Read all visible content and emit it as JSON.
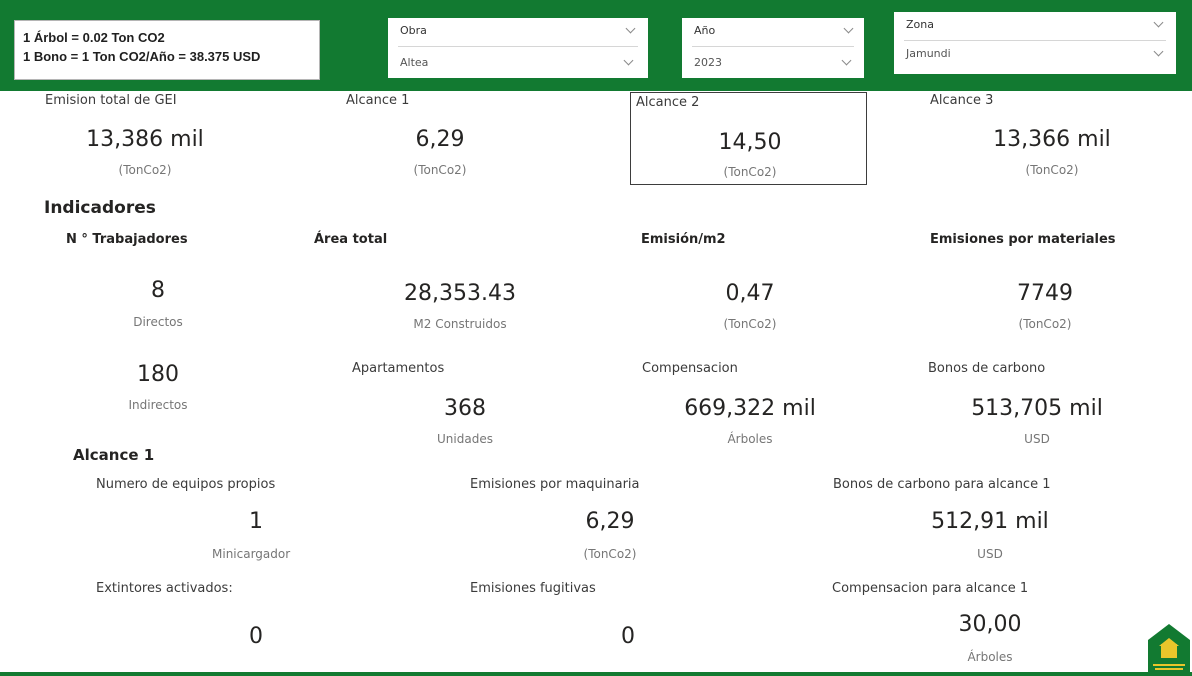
{
  "info": {
    "line1": "1 Árbol = 0.02 Ton CO2",
    "line2": "1 Bono = 1 Ton CO2/Año = 38.375 USD"
  },
  "filters": {
    "obra": {
      "title": "Obra",
      "value": "Altea"
    },
    "anio": {
      "title": "Año",
      "value": "2023"
    },
    "zona": {
      "title": "Zona",
      "value": "Jamundi"
    }
  },
  "emissions": {
    "total": {
      "label": "Emision total de GEI",
      "value": "13,386 mil",
      "unit": "(TonCo2)"
    },
    "alcance1": {
      "label": "Alcance 1",
      "value": "6,29",
      "unit": "(TonCo2)"
    },
    "alcance2": {
      "label": "Alcance 2",
      "value": "14,50",
      "unit": "(TonCo2)"
    },
    "alcance3": {
      "label": "Alcance 3",
      "value": "13,366 mil",
      "unit": "(TonCo2)"
    }
  },
  "indicadores": {
    "title": "Indicadores",
    "trabajadores": {
      "label": "N ° Trabajadores",
      "directos_value": "8",
      "directos_unit": "Directos",
      "indirectos_value": "180",
      "indirectos_unit": "Indirectos"
    },
    "area": {
      "label": "Área total",
      "value": "28,353.43",
      "unit": "M2 Construidos"
    },
    "emision_m2": {
      "label": "Emisión/m2",
      "value": "0,47",
      "unit": "(TonCo2)"
    },
    "materiales": {
      "label": "Emisiones por materiales",
      "value": "7749",
      "unit": "(TonCo2)"
    },
    "apartamentos": {
      "label": "Apartamentos",
      "value": "368",
      "unit": "Unidades"
    },
    "compensacion": {
      "label": "Compensacion",
      "value": "669,322 mil",
      "unit": "Árboles"
    },
    "bonos": {
      "label": "Bonos de carbono",
      "value": "513,705 mil",
      "unit": "USD"
    }
  },
  "alcance1_section": {
    "title": "Alcance 1",
    "equipos": {
      "label": "Numero de equipos propios",
      "value": "1",
      "unit": "Minicargador"
    },
    "maquinaria": {
      "label": "Emisiones por maquinaria",
      "value": "6,29",
      "unit": "(TonCo2)"
    },
    "bonos_a1": {
      "label": "Bonos de carbono para alcance 1",
      "value": "512,91 mil",
      "unit": "USD"
    },
    "extintores": {
      "label": "Extintores activados:",
      "value": "0"
    },
    "fugitivas": {
      "label": "Emisiones fugitivas",
      "value": "0"
    },
    "compensacion_a1": {
      "label": "Compensacion para alcance 1",
      "value": "30,00",
      "unit": "Árboles"
    }
  },
  "colors": {
    "brand_green": "#127a31",
    "logo_yellow": "#e9c62b"
  }
}
